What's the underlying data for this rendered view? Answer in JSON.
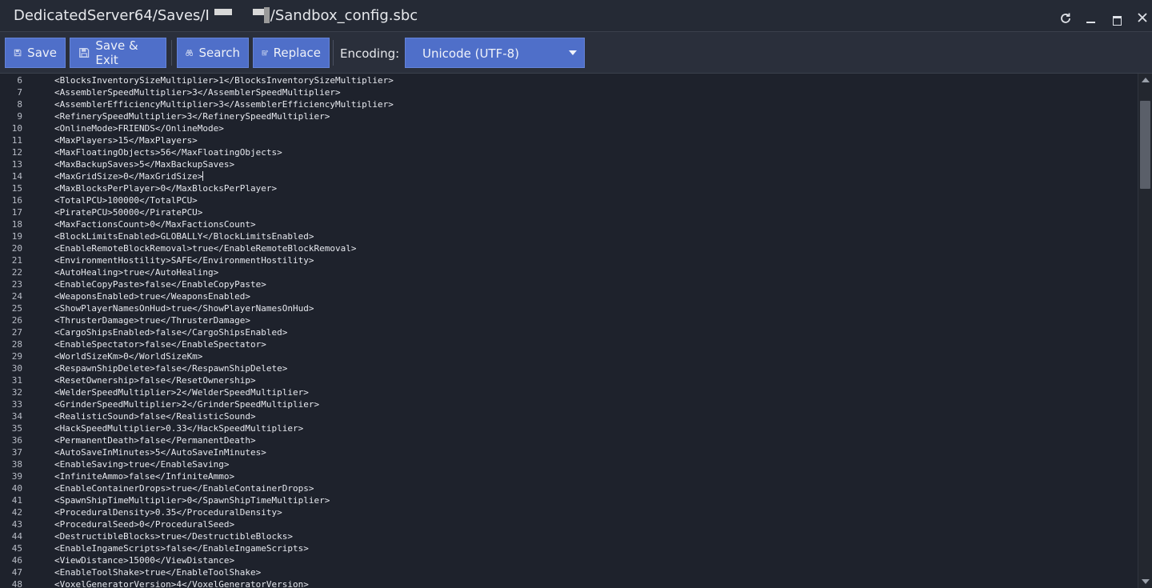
{
  "window": {
    "title_prefix": "DedicatedServer64/Saves/I",
    "title_suffix": "/Sandbox_config.sbc"
  },
  "toolbar": {
    "save_label": "Save",
    "save_exit_label": "Save & Exit",
    "search_label": "Search",
    "replace_label": "Replace",
    "encoding_label": "Encoding:",
    "encoding_value": "Unicode (UTF-8)"
  },
  "editor": {
    "caret_line": 14,
    "lines": [
      {
        "n": "6",
        "text": "<BlocksInventorySizeMultiplier>1</BlocksInventorySizeMultiplier>"
      },
      {
        "n": "7",
        "text": "<AssemblerSpeedMultiplier>3</AssemblerSpeedMultiplier>"
      },
      {
        "n": "8",
        "text": "<AssemblerEfficiencyMultiplier>3</AssemblerEfficiencyMultiplier>"
      },
      {
        "n": "9",
        "text": "<RefinerySpeedMultiplier>3</RefinerySpeedMultiplier>"
      },
      {
        "n": "10",
        "text": "<OnlineMode>FRIENDS</OnlineMode>"
      },
      {
        "n": "11",
        "text": "<MaxPlayers>15</MaxPlayers>"
      },
      {
        "n": "12",
        "text": "<MaxFloatingObjects>56</MaxFloatingObjects>"
      },
      {
        "n": "13",
        "text": "<MaxBackupSaves>5</MaxBackupSaves>"
      },
      {
        "n": "14",
        "text": "<MaxGridSize>0</MaxGridSize>"
      },
      {
        "n": "15",
        "text": "<MaxBlocksPerPlayer>0</MaxBlocksPerPlayer>"
      },
      {
        "n": "16",
        "text": "<TotalPCU>100000</TotalPCU>"
      },
      {
        "n": "17",
        "text": "<PiratePCU>50000</PiratePCU>"
      },
      {
        "n": "18",
        "text": "<MaxFactionsCount>0</MaxFactionsCount>"
      },
      {
        "n": "19",
        "text": "<BlockLimitsEnabled>GLOBALLY</BlockLimitsEnabled>"
      },
      {
        "n": "20",
        "text": "<EnableRemoteBlockRemoval>true</EnableRemoteBlockRemoval>"
      },
      {
        "n": "21",
        "text": "<EnvironmentHostility>SAFE</EnvironmentHostility>"
      },
      {
        "n": "22",
        "text": "<AutoHealing>true</AutoHealing>"
      },
      {
        "n": "23",
        "text": "<EnableCopyPaste>false</EnableCopyPaste>"
      },
      {
        "n": "24",
        "text": "<WeaponsEnabled>true</WeaponsEnabled>"
      },
      {
        "n": "25",
        "text": "<ShowPlayerNamesOnHud>true</ShowPlayerNamesOnHud>"
      },
      {
        "n": "26",
        "text": "<ThrusterDamage>true</ThrusterDamage>"
      },
      {
        "n": "27",
        "text": "<CargoShipsEnabled>false</CargoShipsEnabled>"
      },
      {
        "n": "28",
        "text": "<EnableSpectator>false</EnableSpectator>"
      },
      {
        "n": "29",
        "text": "<WorldSizeKm>0</WorldSizeKm>"
      },
      {
        "n": "30",
        "text": "<RespawnShipDelete>false</RespawnShipDelete>"
      },
      {
        "n": "31",
        "text": "<ResetOwnership>false</ResetOwnership>"
      },
      {
        "n": "32",
        "text": "<WelderSpeedMultiplier>2</WelderSpeedMultiplier>"
      },
      {
        "n": "33",
        "text": "<GrinderSpeedMultiplier>2</GrinderSpeedMultiplier>"
      },
      {
        "n": "34",
        "text": "<RealisticSound>false</RealisticSound>"
      },
      {
        "n": "35",
        "text": "<HackSpeedMultiplier>0.33</HackSpeedMultiplier>"
      },
      {
        "n": "36",
        "text": "<PermanentDeath>false</PermanentDeath>"
      },
      {
        "n": "37",
        "text": "<AutoSaveInMinutes>5</AutoSaveInMinutes>"
      },
      {
        "n": "38",
        "text": "<EnableSaving>true</EnableSaving>"
      },
      {
        "n": "39",
        "text": "<InfiniteAmmo>false</InfiniteAmmo>"
      },
      {
        "n": "40",
        "text": "<EnableContainerDrops>true</EnableContainerDrops>"
      },
      {
        "n": "41",
        "text": "<SpawnShipTimeMultiplier>0</SpawnShipTimeMultiplier>"
      },
      {
        "n": "42",
        "text": "<ProceduralDensity>0.35</ProceduralDensity>"
      },
      {
        "n": "43",
        "text": "<ProceduralSeed>0</ProceduralSeed>"
      },
      {
        "n": "44",
        "text": "<DestructibleBlocks>true</DestructibleBlocks>"
      },
      {
        "n": "45",
        "text": "<EnableIngameScripts>false</EnableIngameScripts>"
      },
      {
        "n": "46",
        "text": "<ViewDistance>15000</ViewDistance>"
      },
      {
        "n": "47",
        "text": "<EnableToolShake>true</EnableToolShake>"
      },
      {
        "n": "48",
        "text": "<VoxelGeneratorVersion>4</VoxelGeneratorVersion>"
      }
    ]
  }
}
